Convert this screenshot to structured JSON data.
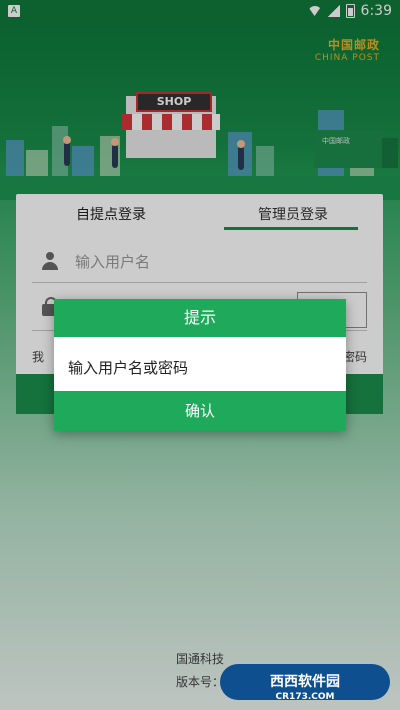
{
  "status_bar": {
    "left_icon": "A",
    "time": "6:39"
  },
  "header": {
    "logo_cn": "中国邮政",
    "logo_en": "CHINA POST",
    "shop_sign": "SHOP",
    "truck_text": "中国邮政"
  },
  "login": {
    "tabs": [
      "自提点登录",
      "管理员登录"
    ],
    "active_tab_index": 1,
    "username_placeholder": "输入用户名",
    "password_placeholder": "",
    "code_button_fragment": "码",
    "left_link_fragment": "我",
    "right_link_fragment": "密码"
  },
  "dialog": {
    "title": "提示",
    "message": "输入用户名或密码",
    "confirm_label": "确认"
  },
  "footer": {
    "line1": "国通科技",
    "line2": "版本号："
  },
  "watermark": {
    "text": "西西软件园",
    "sub": "CR173.COM"
  }
}
